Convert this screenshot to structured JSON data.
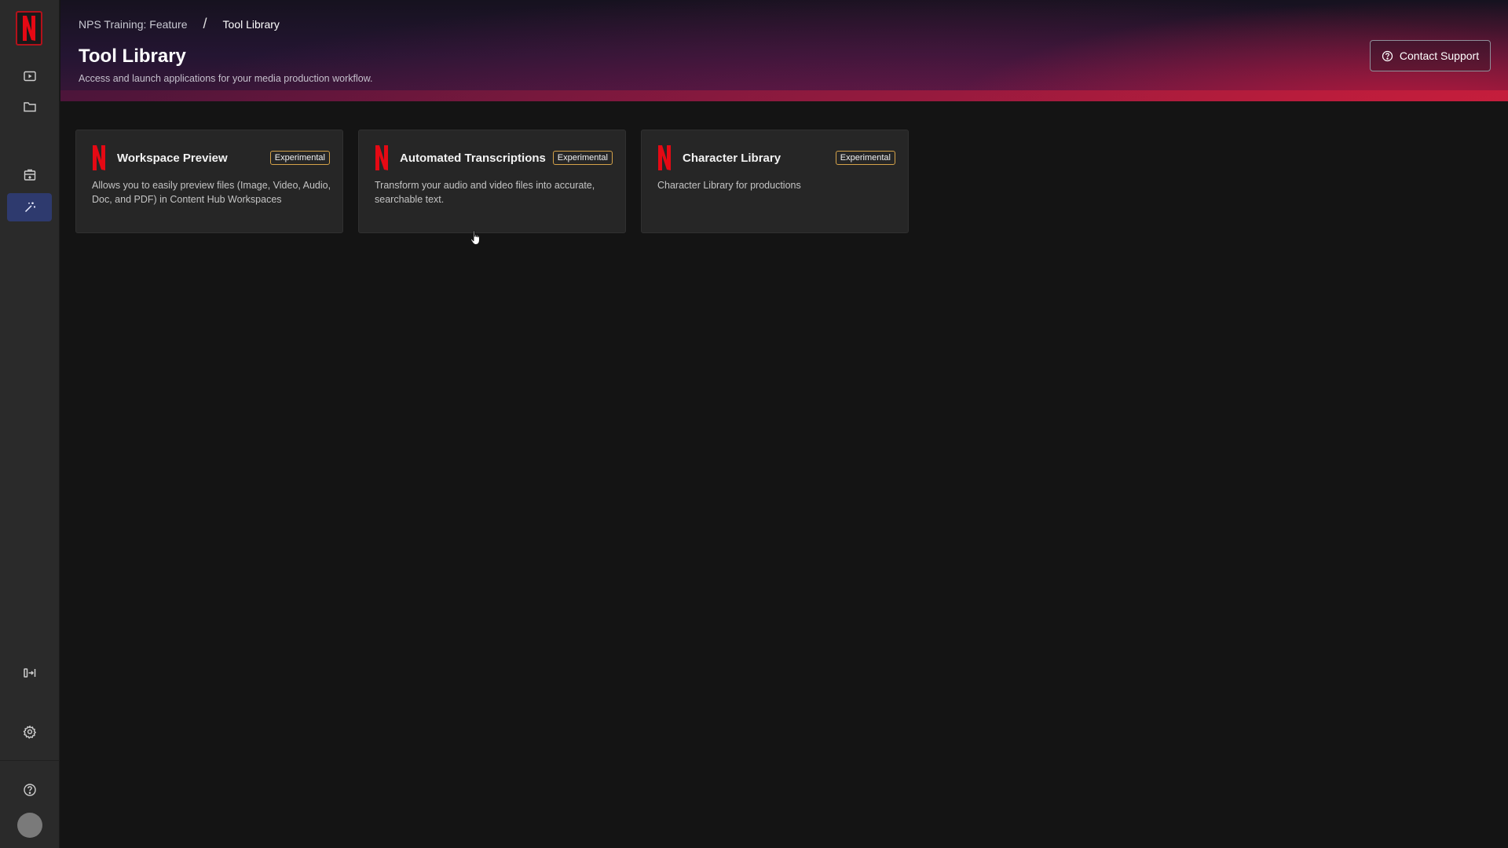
{
  "sidebar": {
    "logo_icon": "netflix-n-logo",
    "items": [
      {
        "name": "video-library",
        "icon": "play-icon"
      },
      {
        "name": "folders",
        "icon": "folder-icon"
      },
      {
        "name": "deliveries",
        "icon": "inbox-icon"
      },
      {
        "name": "tool-library",
        "icon": "magic-wand-icon",
        "active": true
      }
    ],
    "bottom": [
      {
        "name": "expand-sidebar",
        "icon": "expand-icon"
      },
      {
        "name": "settings",
        "icon": "gear-icon"
      },
      {
        "name": "help",
        "icon": "help-icon"
      }
    ]
  },
  "header": {
    "breadcrumb": {
      "parent": "NPS Training: Feature",
      "separator": "/",
      "current": "Tool Library"
    },
    "title": "Tool Library",
    "subtitle": "Access and launch applications for your media production workflow.",
    "support_label": "Contact Support"
  },
  "tools": [
    {
      "title": "Workspace Preview",
      "badge": "Experimental",
      "description": "Allows you to easily preview files (Image, Video, Audio, Doc, and PDF) in Content Hub Workspaces"
    },
    {
      "title": "Automated Transcriptions",
      "badge": "Experimental",
      "description": "Transform your audio and video files into accurate, searchable text."
    },
    {
      "title": "Character Library",
      "badge": "Experimental",
      "description": "Character Library for productions"
    }
  ],
  "colors": {
    "brand_red": "#b3121b",
    "active_nav": "#2e3a6e",
    "badge_border": "#d4a24a",
    "background": "#141414"
  }
}
